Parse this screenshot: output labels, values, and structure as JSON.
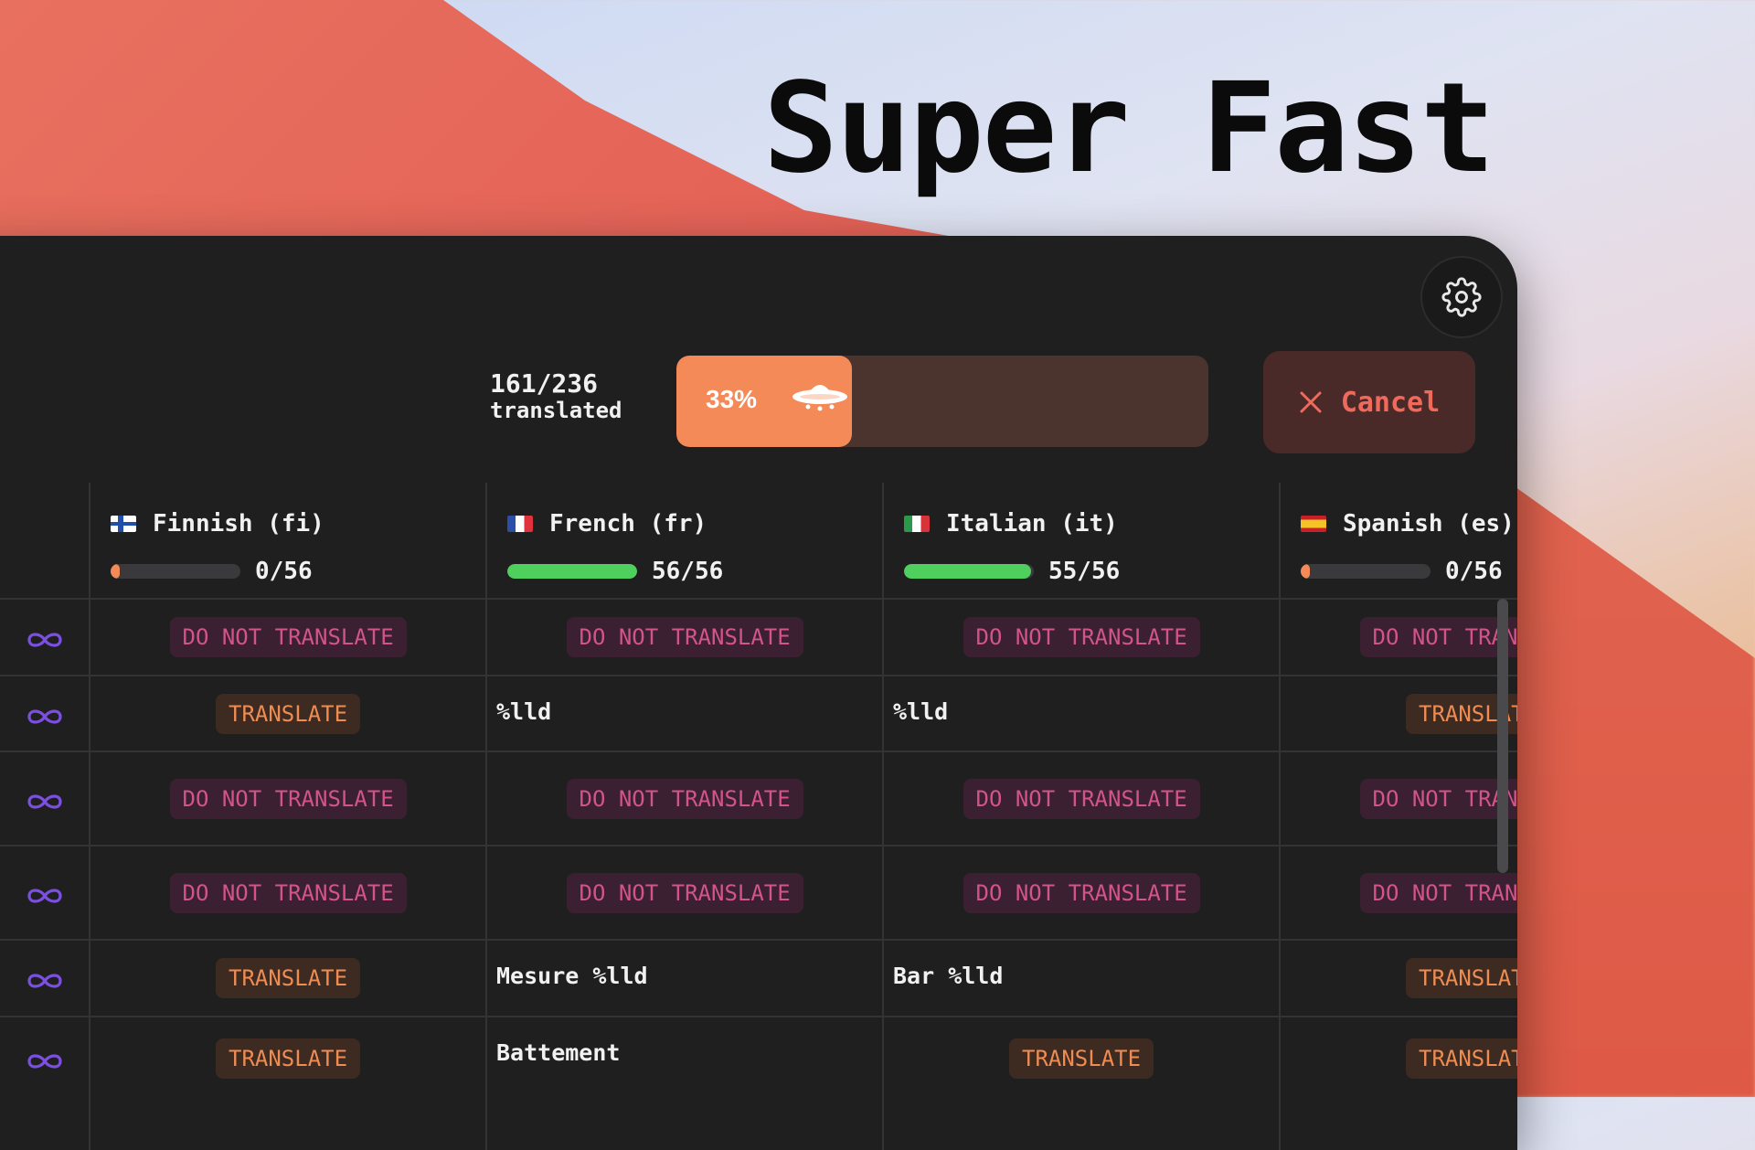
{
  "headline": "Super Fast",
  "progress": {
    "count": "161/236",
    "label": "translated",
    "percent_text": "33%",
    "fraction": 0.33,
    "cancel_label": "Cancel"
  },
  "languages": [
    {
      "name": "Finnish (fi)",
      "count": "0/56",
      "fraction": 0.0,
      "flag": "fi"
    },
    {
      "name": "French (fr)",
      "count": "56/56",
      "fraction": 1.0,
      "flag": "fr"
    },
    {
      "name": "Italian (it)",
      "count": "55/56",
      "fraction": 0.98,
      "flag": "it"
    },
    {
      "name": "Spanish (es)",
      "count": "0/56",
      "fraction": 0.0,
      "flag": "es"
    }
  ],
  "rows": [
    {
      "cells": [
        {
          "tag": "DO NOT TRANSLATE"
        },
        {
          "tag": "DO NOT TRANSLATE"
        },
        {
          "tag": "DO NOT TRANSLATE"
        },
        {
          "tag": "DO NOT TRANSLATE"
        }
      ]
    },
    {
      "cells": [
        {
          "tag": "TRANSLATE"
        },
        {
          "text": "%lld"
        },
        {
          "text": "%lld"
        },
        {
          "tag": "TRANSLATE"
        }
      ]
    },
    {
      "cells": [
        {
          "tag": "DO NOT TRANSLATE"
        },
        {
          "tag": "DO NOT TRANSLATE"
        },
        {
          "tag": "DO NOT TRANSLATE"
        },
        {
          "tag": "DO NOT TRANSLATE"
        }
      ]
    },
    {
      "cells": [
        {
          "tag": "DO NOT TRANSLATE"
        },
        {
          "tag": "DO NOT TRANSLATE"
        },
        {
          "tag": "DO NOT TRANSLATE"
        },
        {
          "tag": "DO NOT TRANSLATE"
        }
      ]
    },
    {
      "cells": [
        {
          "tag": "TRANSLATE"
        },
        {
          "text": "Mesure %lld"
        },
        {
          "text": "Bar %lld"
        },
        {
          "tag": "TRANSLATE"
        }
      ]
    },
    {
      "cells": [
        {
          "tag": "TRANSLATE"
        },
        {
          "text": "Battement"
        },
        {
          "tag": "TRANSLATE"
        },
        {
          "tag": "TRANSLATE"
        }
      ]
    }
  ],
  "colors": {
    "progress_fill": "#f48a58",
    "complete_bar": "#4fcf5e",
    "dnt_text": "#d2548a",
    "translate_text": "#ee8c52",
    "loop_icon": "#7b4fe0",
    "cancel_text": "#f06a5c"
  },
  "icons": {
    "settings": "gear-icon",
    "cancel": "close-icon",
    "progress": "ufo-icon",
    "row": "infinity-loop-icon"
  }
}
